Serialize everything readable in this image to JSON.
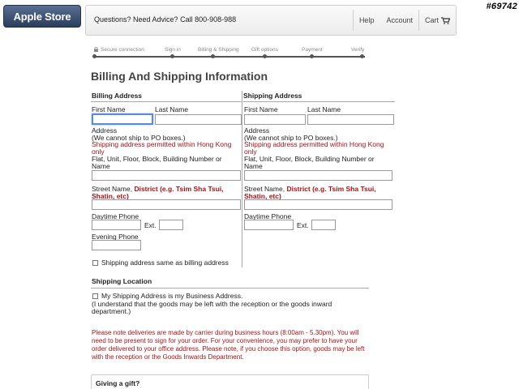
{
  "header": {
    "store_logo": "Apple Store",
    "advice_label": "Questions? Need Advice?",
    "advice_phone": "Call 800-908-988",
    "help": "Help",
    "account": "Account",
    "cart": "Cart",
    "cart_icon": "cart-icon"
  },
  "watermark": "#69742",
  "progress": {
    "steps": [
      "Secure connection",
      "Sign in",
      "Billing & Shipping",
      "Gift options",
      "Payment",
      "Verify"
    ]
  },
  "page_title": "Billing And Shipping Information",
  "billing": {
    "title": "Billing Address",
    "first_name": "First Name",
    "last_name": "Last Name",
    "address": "Address",
    "po_note": "(We cannot ship to PO boxes.)",
    "hk_note": "Shipping address permitted within Hong Kong only",
    "flat_label": "Flat, Unit, Floor, Block, Building Number or Name",
    "street_prefix": "Street Name,",
    "street_district": "District (e.g. Tsim Sha Tsui, Shatin, etc)",
    "daytime_phone": "Daytime Phone",
    "ext": "Ext.",
    "evening_phone": "Evening Phone",
    "same_as_billing": "Shipping address same as billing address"
  },
  "shipping": {
    "title": "Shipping Address",
    "first_name": "First Name",
    "last_name": "Last Name",
    "address": "Address",
    "po_note": "(We cannot ship to PO boxes.)",
    "hk_note": "Shipping address permitted within Hong Kong only",
    "flat_label": "Flat, Unit, Floor, Block, Building Number or Name",
    "street_prefix": "Street Name,",
    "street_district": "District (e.g. Tsim Sha Tsui, Shatin, etc)",
    "daytime_phone": "Daytime Phone",
    "ext": "Ext."
  },
  "shipping_location": {
    "title": "Shipping Location",
    "business_label": "My Shipping Address is my Business Address.",
    "business_note": "(I understand that the goods may be left with the reception or the goods inward department.)"
  },
  "delivery_notice": "Please note deliveries are made by carrier during business hours (8:00am - 5.30pm). You will need to be present to sign for your order. For your convenience, you may prefer to have your order delivered to your office address. Please note, if you choose this option, goods may be left with the reception or the Goods Inwards Department.",
  "gift": {
    "title": "Giving a gift?"
  },
  "colors": {
    "accent_red": "#a0141a",
    "focus_blue": "#5a8bd8",
    "logo_blue": "#3a4d70"
  }
}
